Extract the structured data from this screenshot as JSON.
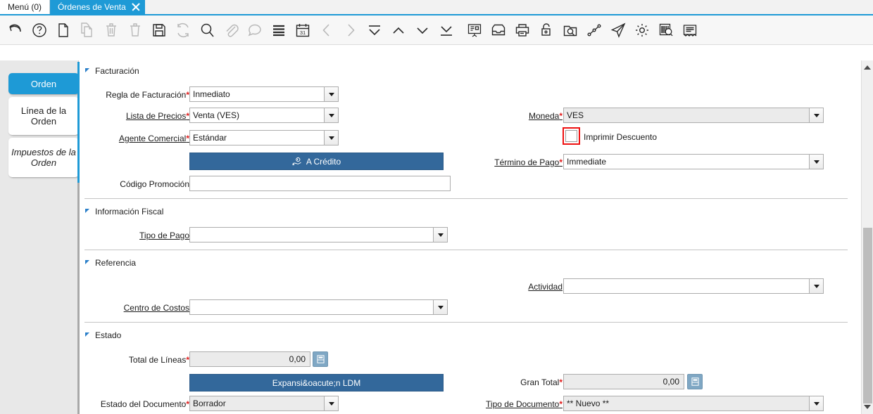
{
  "window_tabs": [
    {
      "label": "Menú (0)",
      "active": false,
      "closable": false
    },
    {
      "label": "Órdenes de Venta",
      "active": true,
      "closable": true
    }
  ],
  "toolbar": {
    "items": [
      {
        "name": "undo-icon",
        "title": "Deshacer",
        "disabled": false
      },
      {
        "name": "help-icon",
        "title": "Ayuda",
        "disabled": false
      },
      {
        "name": "new-record-icon",
        "title": "Nuevo Registro",
        "disabled": false
      },
      {
        "name": "copy-record-icon",
        "title": "Copiar Registro",
        "disabled": true
      },
      {
        "name": "delete-record-icon",
        "title": "Eliminar Registro",
        "disabled": true
      },
      {
        "name": "delete-selection-icon",
        "title": "Eliminar Selección",
        "disabled": true
      },
      {
        "name": "save-icon",
        "title": "Guardar Cambios",
        "disabled": false
      },
      {
        "name": "refresh-icon",
        "title": "Refrescar",
        "disabled": true
      },
      {
        "name": "search-icon",
        "title": "Buscar Registros",
        "disabled": false
      },
      {
        "name": "attachment-icon",
        "title": "Adjunto",
        "disabled": true
      },
      {
        "name": "chat-icon",
        "title": "Nota de Registro",
        "disabled": true
      },
      {
        "name": "grid-toggle-icon",
        "title": "Alternar Vista",
        "disabled": false
      },
      {
        "name": "calendar-icon",
        "title": "Calendario",
        "disabled": false
      },
      {
        "name": "previous-record-icon",
        "title": "Registro Anterior",
        "disabled": true
      },
      {
        "name": "next-record-icon",
        "title": "Registro Siguiente",
        "disabled": true
      },
      {
        "name": "first-record-icon",
        "title": "Primer Registro",
        "disabled": false
      },
      {
        "name": "up-record-icon",
        "title": "Registro Arriba",
        "disabled": false
      },
      {
        "name": "down-record-icon",
        "title": "Registro Abajo",
        "disabled": false
      },
      {
        "name": "last-record-icon",
        "title": "Último Registro",
        "disabled": false
      },
      {
        "name": "report-view-icon",
        "title": "Reporte",
        "disabled": false
      },
      {
        "name": "archive-icon",
        "title": "Archivo",
        "disabled": false
      },
      {
        "name": "print-icon",
        "title": "Imprimir",
        "disabled": false
      },
      {
        "name": "lock-icon",
        "title": "Bloquear Registro",
        "disabled": false
      },
      {
        "name": "zoom-across-icon",
        "title": "Zoom Across",
        "disabled": false
      },
      {
        "name": "workflow-icon",
        "title": "Flujo de Trabajo",
        "disabled": false
      },
      {
        "name": "send-icon",
        "title": "Enviar",
        "disabled": false
      },
      {
        "name": "gear-icon",
        "title": "Preferencias",
        "disabled": false
      },
      {
        "name": "barcode-icon",
        "title": "Código de Barras",
        "disabled": false
      },
      {
        "name": "document-report-icon",
        "title": "Documento",
        "disabled": false
      }
    ]
  },
  "rail": {
    "tabs": [
      {
        "label": "Orden",
        "state": "sel"
      },
      {
        "label": "Línea de la Orden",
        "state": "norm"
      },
      {
        "label": "Impuestos de la Orden",
        "state": "ital"
      }
    ]
  },
  "sections": {
    "facturacion": {
      "title": "Facturación"
    },
    "informacion_fiscal": {
      "title": "Información Fiscal"
    },
    "referencia": {
      "title": "Referencia"
    },
    "estado": {
      "title": "Estado"
    }
  },
  "fields": {
    "regla_facturacion": {
      "label": "Regla de Facturación",
      "value": "Inmediato"
    },
    "lista_precios": {
      "label": "Lista de Precios",
      "value": "Venta (VES)"
    },
    "agente_comercial": {
      "label": "Agente Comercial",
      "value": "Estándar"
    },
    "codigo_promocion": {
      "label": "Código Promoción",
      "value": ""
    },
    "moneda": {
      "label": "Moneda",
      "value": "VES"
    },
    "termino_pago": {
      "label": "Término de Pago",
      "value": "Immediate"
    },
    "tipo_pago": {
      "label": "Tipo de Pago",
      "value": ""
    },
    "actividad": {
      "label": "Actividad",
      "value": ""
    },
    "centro_costos": {
      "label": "Centro de Costos",
      "value": ""
    },
    "total_lineas": {
      "label": "Total de Líneas",
      "value": "0,00"
    },
    "gran_total": {
      "label": "Gran Total",
      "value": "0,00"
    },
    "estado_documento": {
      "label": "Estado del Documento",
      "value": "Borrador"
    },
    "tipo_documento": {
      "label": "Tipo de Documento",
      "value": "** Nuevo **"
    }
  },
  "checkbox": {
    "imprimir_descuento": {
      "label": "Imprimir Descuento",
      "checked": false
    }
  },
  "buttons": {
    "a_credito": {
      "label": "A Crédito"
    },
    "expansion_ldm": {
      "label": "Expansi&oacute;n LDM"
    }
  },
  "colors": {
    "accent_blue": "#1e9ad6",
    "button_blue": "#33689b",
    "required_red": "#e01b1b",
    "highlight_red": "#ee1111",
    "section_triangle": "#2a7fc9"
  }
}
